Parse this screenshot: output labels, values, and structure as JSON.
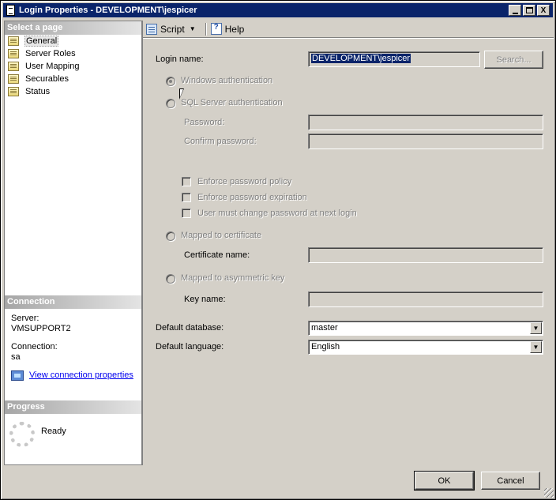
{
  "window": {
    "title": "Login Properties - DEVELOPMENT\\jespicer",
    "controls": {
      "minimize": "_",
      "maximize": "□",
      "close": "X"
    }
  },
  "left": {
    "select_page_header": "Select a page",
    "pages": [
      {
        "label": "General",
        "selected": true
      },
      {
        "label": "Server Roles",
        "selected": false
      },
      {
        "label": "User Mapping",
        "selected": false
      },
      {
        "label": "Securables",
        "selected": false
      },
      {
        "label": "Status",
        "selected": false
      }
    ],
    "connection_header": "Connection",
    "server_label": "Server:",
    "server_value": "VMSUPPORT2",
    "connection_label": "Connection:",
    "connection_value": "sa",
    "view_connection_link": "View connection properties",
    "progress_header": "Progress",
    "progress_status": "Ready"
  },
  "toolbar": {
    "script_label": "Script",
    "script_caret": "▼",
    "help_label": "Help"
  },
  "form": {
    "login_name_label": "Login name:",
    "login_name_value": "DEVELOPMENT\\jespicer",
    "search_button": "Search...",
    "windows_auth_label": "Windows authentication",
    "sql_auth_label": "SQL Server authentication",
    "password_label": "Password:",
    "confirm_password_label": "Confirm password:",
    "enforce_policy_label": "Enforce password policy",
    "enforce_expiration_label": "Enforce password expiration",
    "must_change_label": "User must change password at next login",
    "mapped_cert_label": "Mapped to certificate",
    "cert_name_label": "Certificate name:",
    "mapped_asym_label": "Mapped to asymmetric key",
    "key_name_label": "Key name:",
    "default_database_label": "Default database:",
    "default_database_value": "master",
    "default_language_label": "Default language:",
    "default_language_value": "English",
    "dropdown_arrow": "▼"
  },
  "buttons": {
    "ok": "OK",
    "cancel": "Cancel"
  }
}
